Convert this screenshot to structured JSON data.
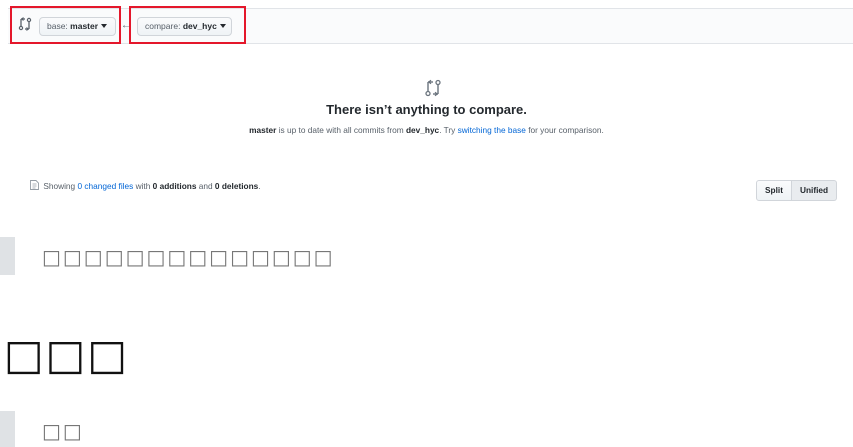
{
  "range_editor": {
    "base_prefix": "base:",
    "base_value": "master",
    "compare_prefix": "compare:",
    "compare_value": "dev_hyc",
    "arrow": "←",
    "highlight_color": "#e4172b"
  },
  "blankslate": {
    "icon": "git-compare-icon",
    "title": "There isn’t anything to compare.",
    "desc_branch": "master",
    "desc_part1": " is up to date with all commits from ",
    "desc_branch2": "dev_hyc",
    "desc_part2": ". Try ",
    "desc_link": "switching the base",
    "desc_part3": " for your comparison."
  },
  "toc": {
    "prefix": "Showing ",
    "changed_files": "0 changed files",
    "mid1": " with ",
    "additions": "0 additions",
    "mid2": " and ",
    "deletions": "0 deletions",
    "suffix": "."
  },
  "diff_view": {
    "split_label": "Split",
    "unified_label": "Unified"
  },
  "content": {
    "quote1": "□□□□□□□□□□□□□□",
    "heading": "□□□",
    "quote2": "□□"
  },
  "colors": {
    "link": "#0366d6",
    "quote_bar": "#dfe2e5"
  }
}
